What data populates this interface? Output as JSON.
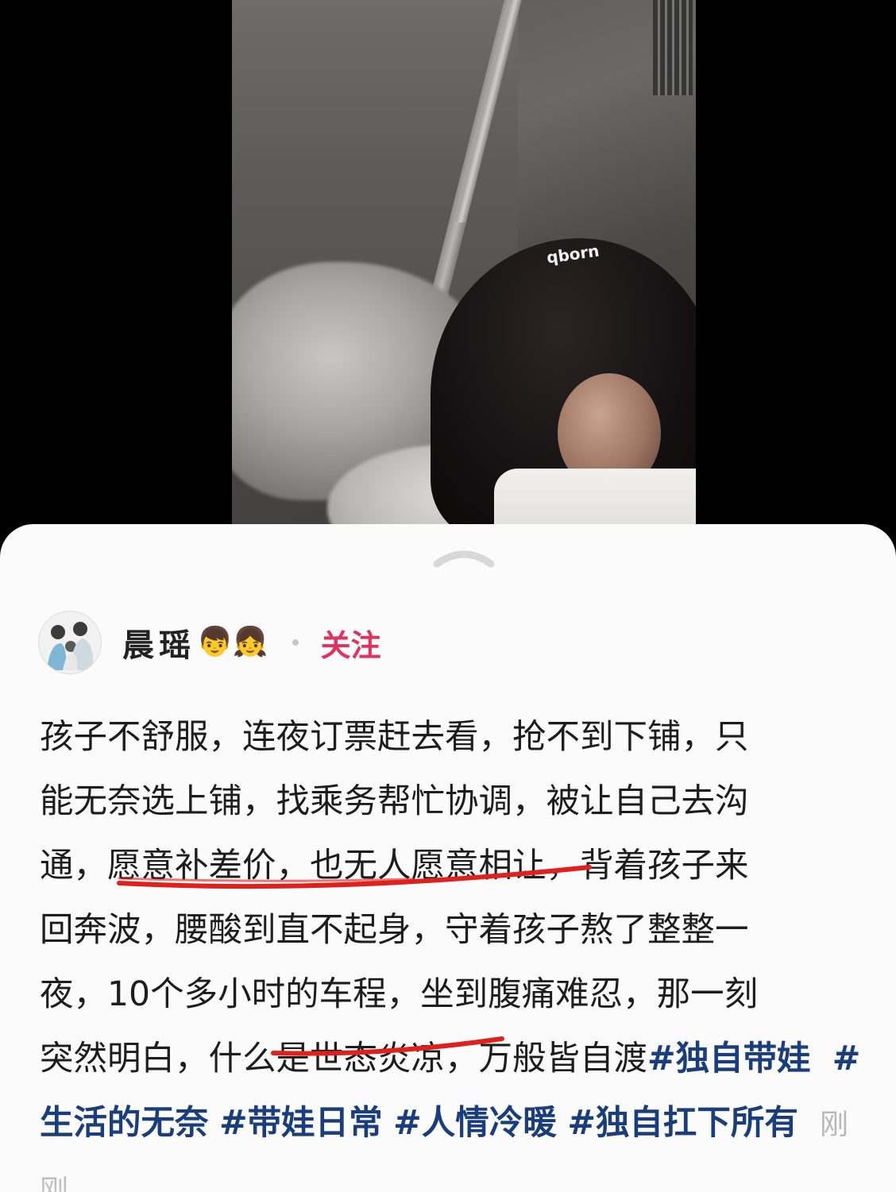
{
  "photo": {
    "brand_text": "qborn"
  },
  "author": {
    "name": "晨瑶",
    "emoji": "👦👧",
    "follow_label": "关注"
  },
  "post": {
    "line1": "孩子不舒服，连夜订票赶去看，抢不到下铺，只",
    "line2": "能无奈选上铺，找乘务帮忙协调，被让自己去沟",
    "line3_a": "通，",
    "line3_b": "愿意补差价，也无人愿意相让",
    "line3_c": "，背着孩子来",
    "line4": "回奔波，腰酸到直不起身，守着孩子熬了整整一",
    "line5": "夜，10个多小时的车程，坐到腹痛难忍，那一刻",
    "line6_a": "突然明白，什",
    "line6_b": "么是世态炎凉",
    "line6_c": "，万般皆自渡",
    "hashtags": [
      "#独自带娃",
      "#生活的无奈",
      "#带娃日常",
      "#人情冷暖",
      "#独自扛下所有"
    ],
    "meta": "刚刚"
  },
  "colors": {
    "follow": "#e0325f",
    "hashtag": "#1a3d7c",
    "underline": "#e0201c"
  }
}
